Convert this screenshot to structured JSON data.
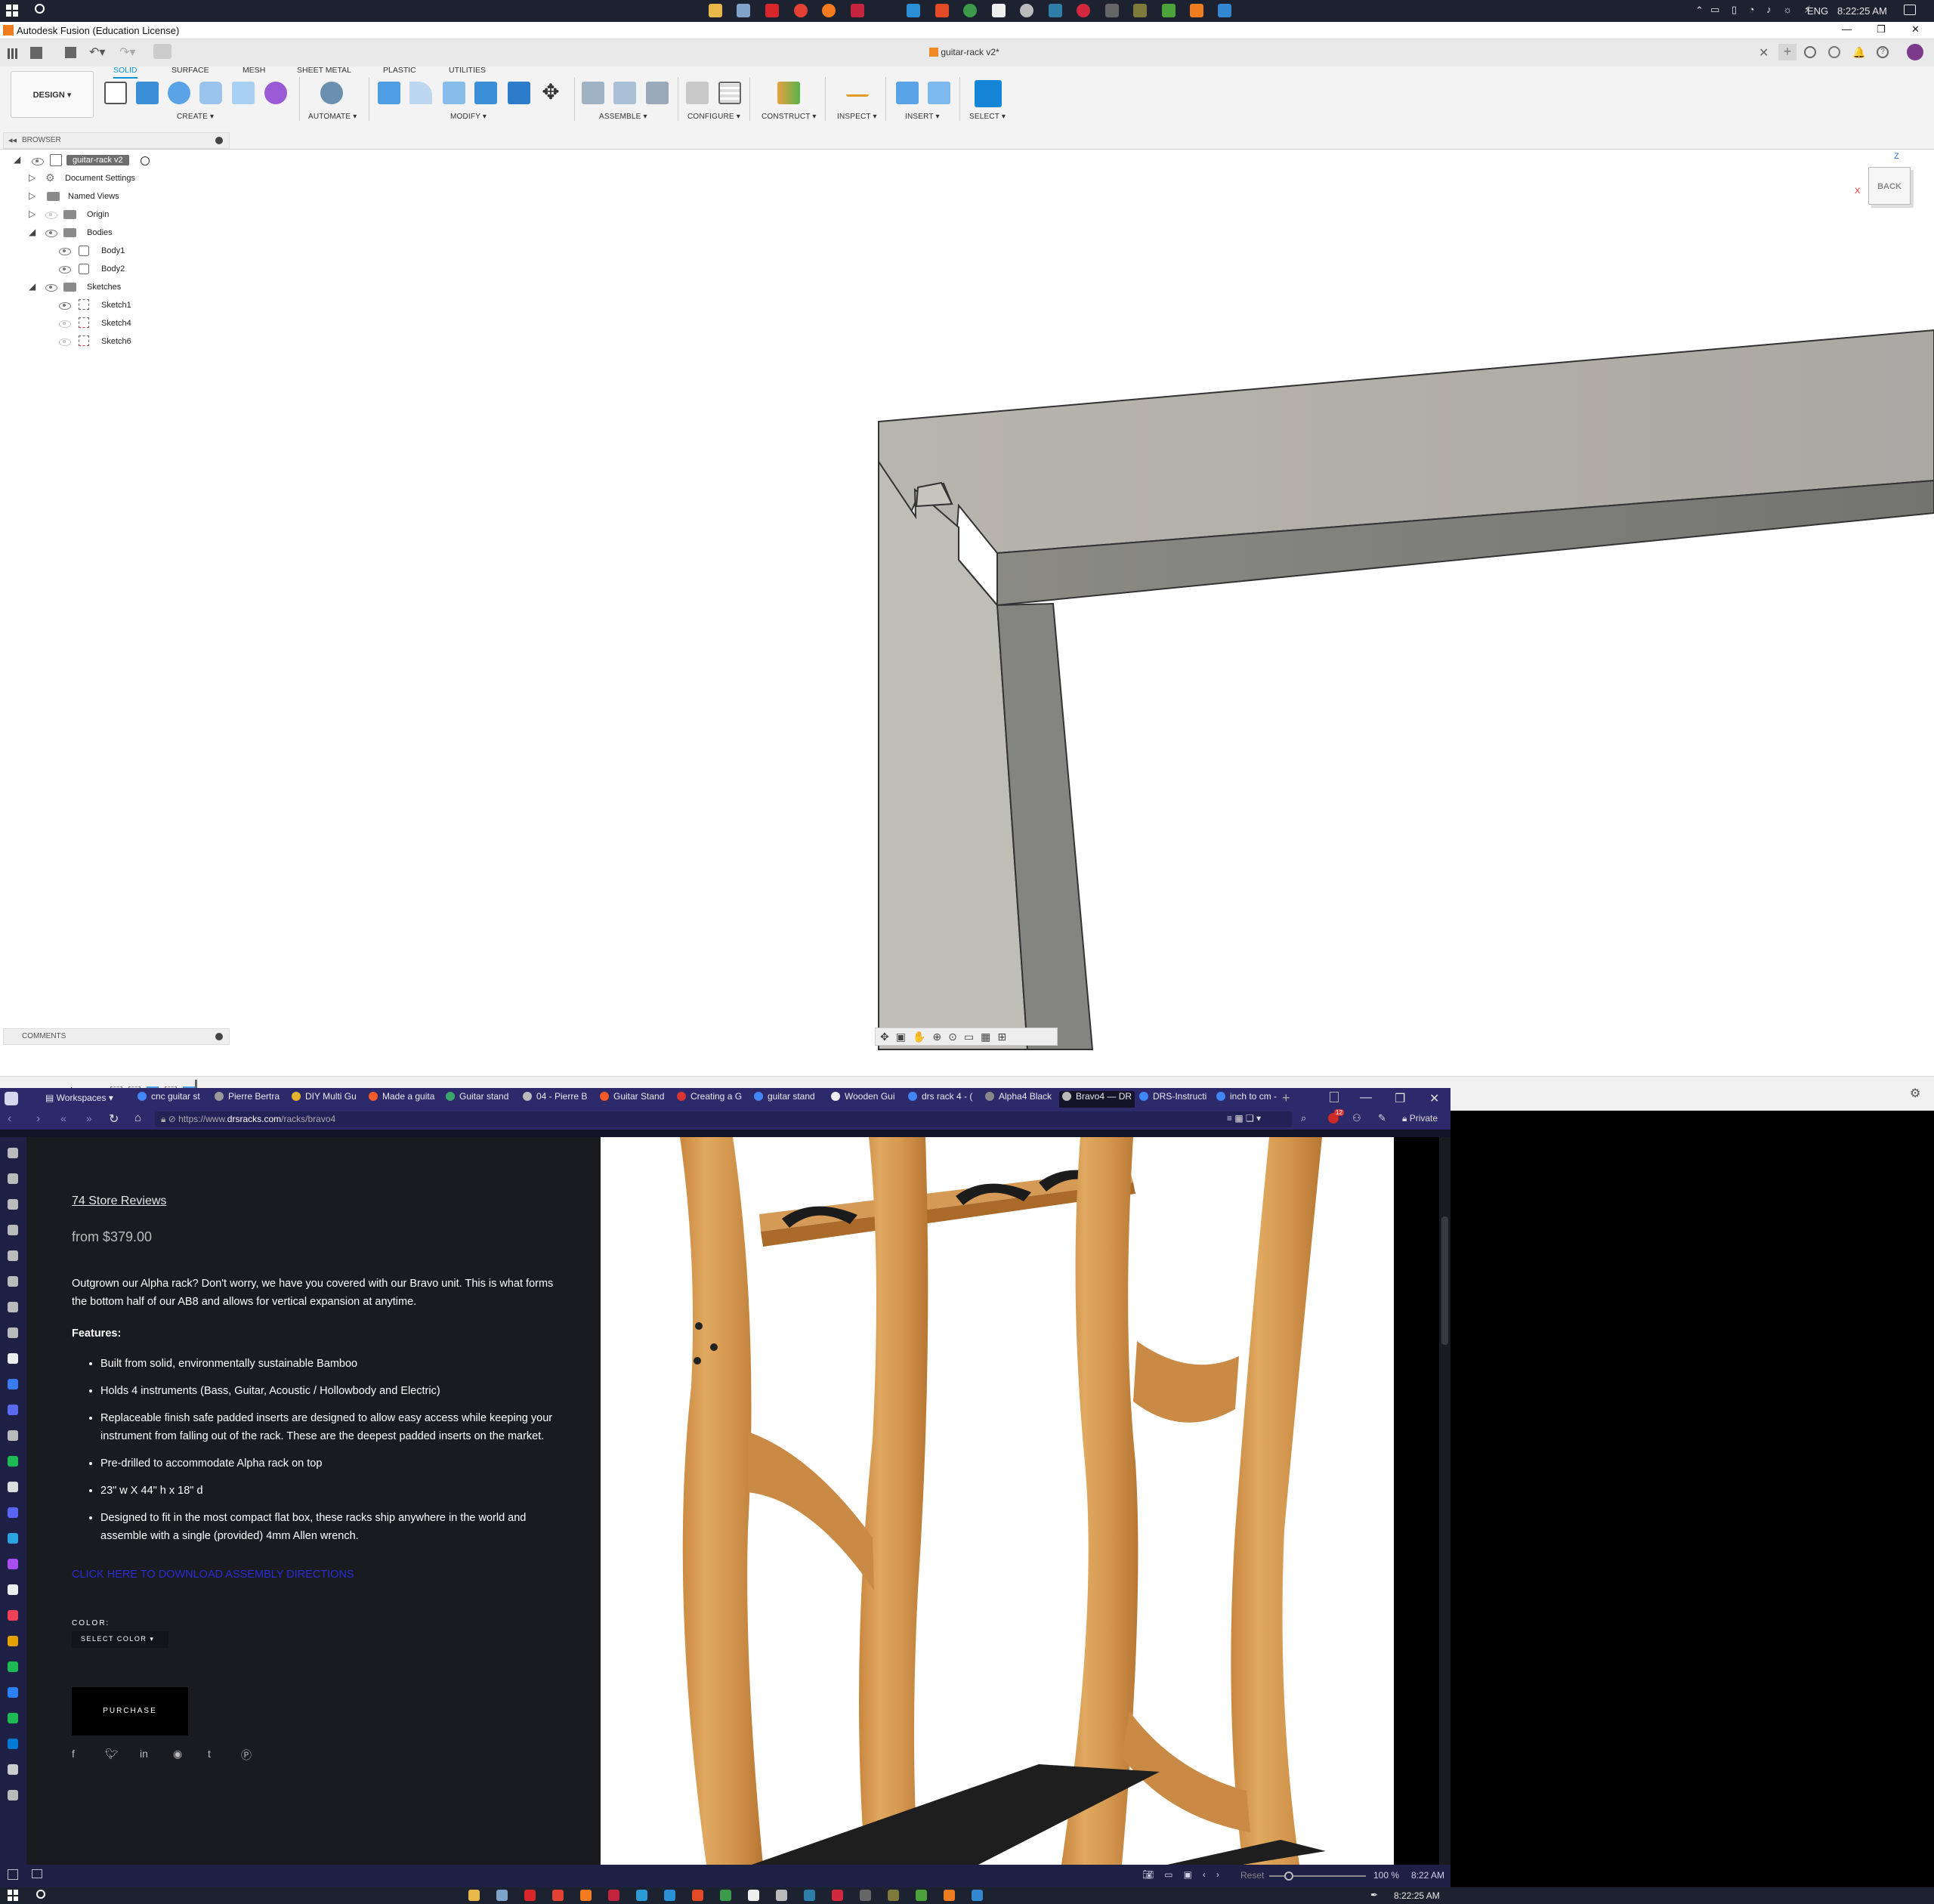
{
  "taskbar_top": {
    "lang": "ENG",
    "time": "8:22:25 AM"
  },
  "fusion": {
    "window_title": "Autodesk Fusion (Education License)",
    "doc_tab": "guitar-rack v2*",
    "design_button": "DESIGN ▾",
    "tabs": [
      "SOLID",
      "SURFACE",
      "MESH",
      "SHEET METAL",
      "PLASTIC",
      "UTILITIES"
    ],
    "groups": [
      "CREATE ▾",
      "AUTOMATE ▾",
      "MODIFY ▾",
      "ASSEMBLE ▾",
      "CONFIGURE ▾",
      "CONSTRUCT ▾",
      "INSPECT ▾",
      "INSERT ▾",
      "SELECT ▾"
    ],
    "browser_title": "BROWSER",
    "comments_title": "COMMENTS",
    "tree": {
      "root": "guitar-rack v2",
      "document_settings": "Document Settings",
      "named_views": "Named Views",
      "origin": "Origin",
      "bodies": "Bodies",
      "body1": "Body1",
      "body2": "Body2",
      "sketches": "Sketches",
      "sketch1": "Sketch1",
      "sketch4": "Sketch4",
      "sketch6": "Sketch6"
    },
    "viewcube_label": "BACK",
    "axes": {
      "z": "Z",
      "x": "X"
    }
  },
  "browser_window": {
    "workspaces": "Workspaces",
    "tabs": [
      "cnc guitar st",
      "Pierre Bertra",
      "DIY Multi Gu",
      "Made a guita",
      "Guitar stand",
      "04 - Pierre B",
      "Guitar Stand",
      "Creating a G",
      "guitar stand",
      "Wooden Gui",
      "drs rack 4 - (",
      "Alpha4 Black",
      "Bravo4 — DR",
      "DRS-Instructi",
      "inch to cm -"
    ],
    "active_tab": 12,
    "url_prefix": "https://www.",
    "url_domain": "drsracks.com",
    "url_path": "/racks/bravo4",
    "private_label": "Private",
    "badge_count": "12",
    "status": {
      "reset": "Reset",
      "zoom": "100 %",
      "time": "8:22 AM"
    }
  },
  "product": {
    "reviews": "74 Store Reviews",
    "price": "from $379.00",
    "description": "Outgrown our Alpha rack? Don't worry, we have you covered with our Bravo unit. This is what forms the bottom half of our AB8 and allows for vertical expansion at anytime.",
    "features_title": "Features:",
    "features": [
      "Built from solid, environmentally sustainable Bamboo",
      "Holds 4 instruments (Bass, Guitar, Acoustic / Hollowbody and Electric)",
      "Replaceable finish safe padded inserts are designed to allow easy access while keeping your instrument from falling out of the rack. These are the deepest padded inserts on the market.",
      "Pre-drilled to accommodate Alpha rack on top",
      "23\" w X 44\" h x 18\" d",
      "Designed to fit in the most compact flat box, these racks ship anywhere in the world and assemble with a single (provided) 4mm Allen wrench."
    ],
    "download_link": "CLICK HERE TO DOWNLOAD ASSEMBLY DIRECTIONS",
    "color_label": "COLOR:",
    "select_color": "SELECT COLOR",
    "purchase": "PURCHASE"
  },
  "taskbar_bottom": {
    "time": "8:22:25 AM"
  }
}
